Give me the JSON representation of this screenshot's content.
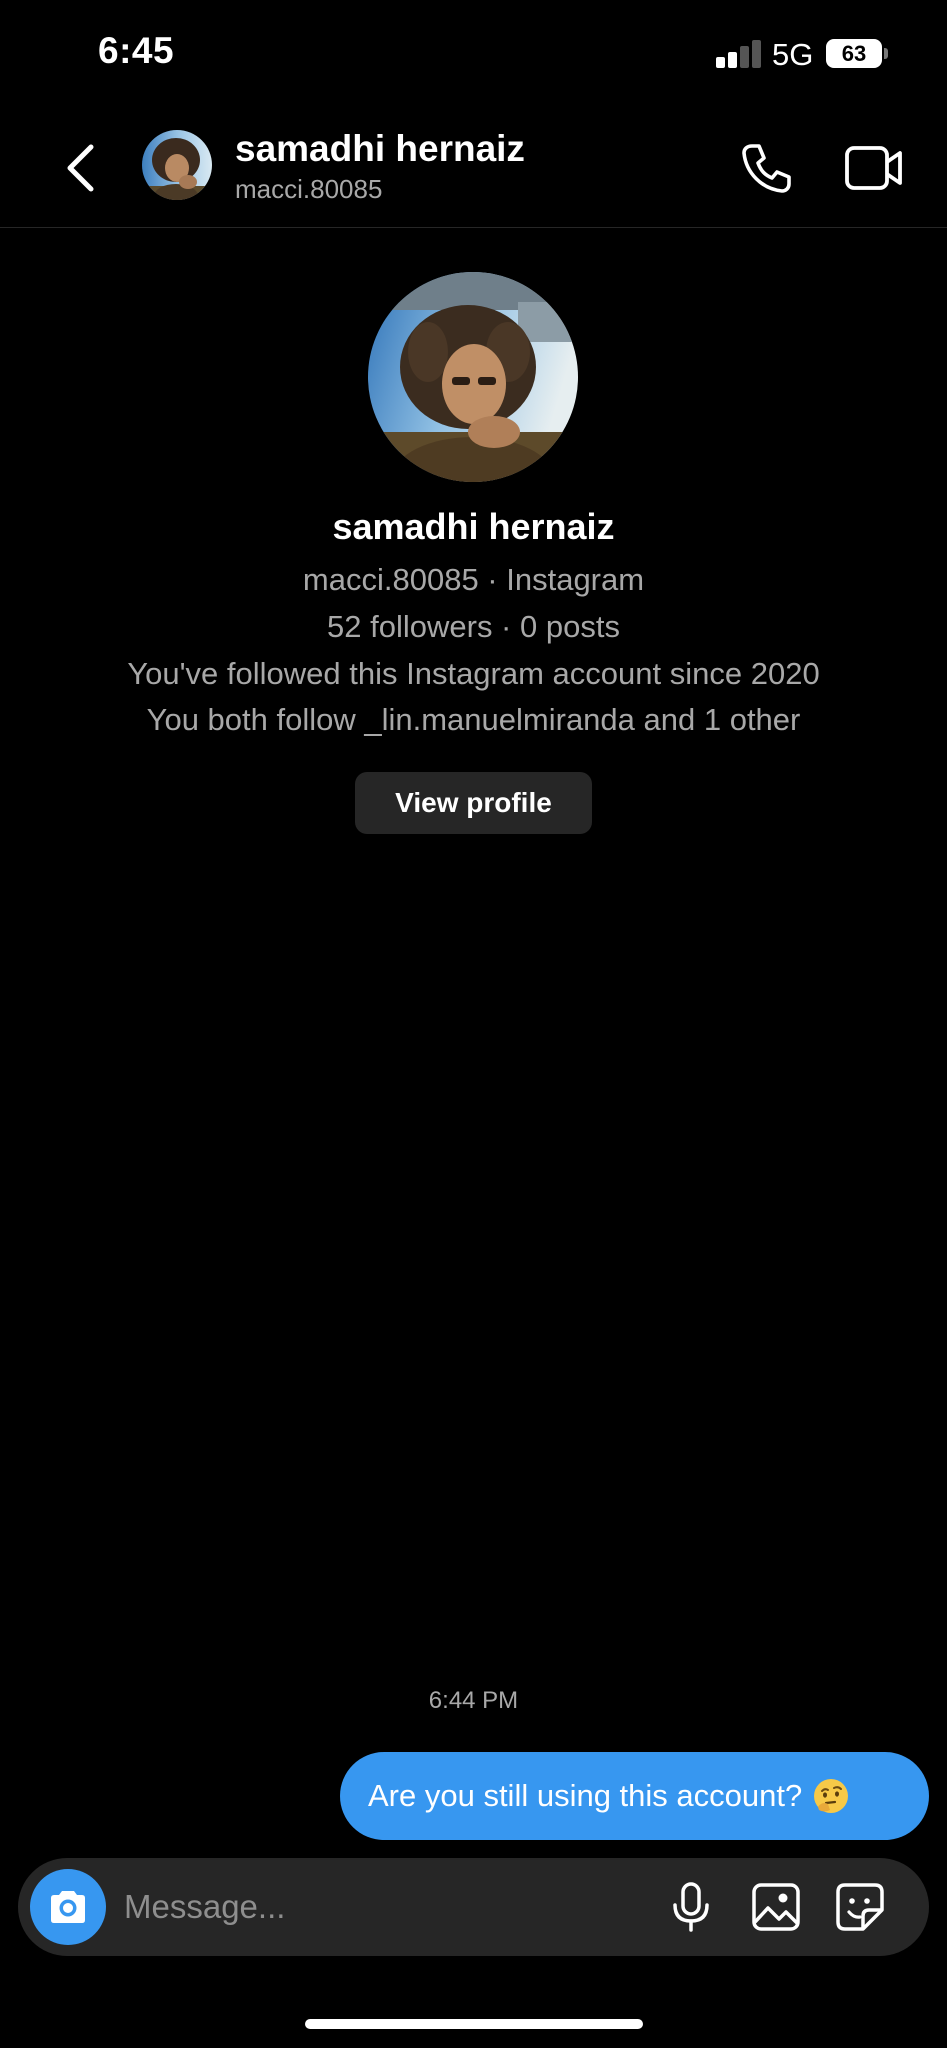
{
  "status_bar": {
    "time": "6:45",
    "network": "5G",
    "battery": "63"
  },
  "header": {
    "name": "samadhi hernaiz",
    "handle": "macci.80085",
    "back_icon": "chevron-left-icon",
    "call_icon": "phone-icon",
    "video_icon": "video-camera-icon"
  },
  "profile": {
    "name": "samadhi hernaiz",
    "handle_line": "macci.80085 · Instagram",
    "stats_line": "52 followers · 0 posts",
    "followed_since": "You've followed this Instagram account since 2020",
    "mutual_follow": "You both follow _lin.manuelmiranda and 1 other",
    "view_profile_label": "View profile"
  },
  "messages": [
    {
      "timestamp": "6:44 PM",
      "text": "Are you still using this account?",
      "emoji": "thinking-face-emoji",
      "sender": "me"
    }
  ],
  "composer": {
    "placeholder": "Message...",
    "camera_icon": "camera-icon",
    "mic_icon": "microphone-icon",
    "gallery_icon": "image-icon",
    "sticker_icon": "sticker-icon"
  },
  "colors": {
    "background": "#000000",
    "accent": "#3797f0",
    "secondary_text": "#a8a8a8",
    "button_bg": "#262626"
  }
}
